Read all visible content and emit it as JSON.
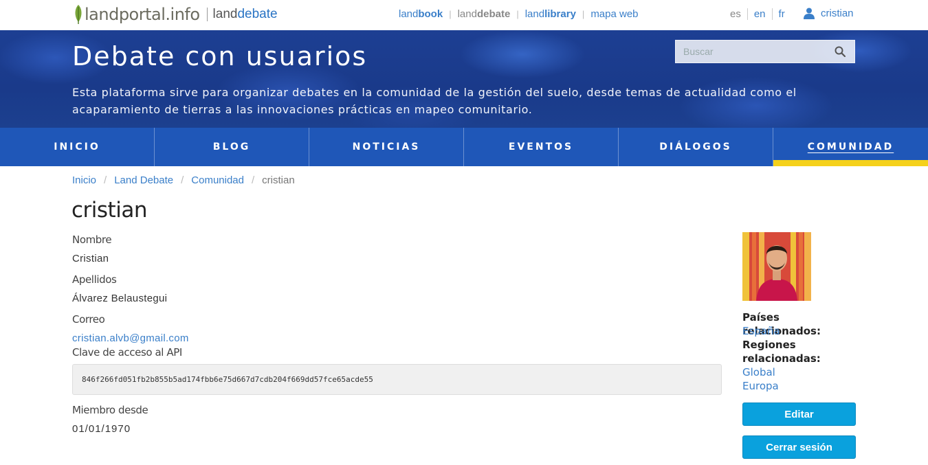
{
  "brand": {
    "logo_text": "landportal.info",
    "sub_land": "land",
    "sub_debate": "debate"
  },
  "sites": [
    {
      "prefix": "land",
      "bold": "book"
    },
    {
      "prefix": "land",
      "bold": "debate"
    },
    {
      "prefix": "land",
      "bold": "library"
    },
    {
      "prefix": "mapa web",
      "bold": ""
    }
  ],
  "languages": [
    "es",
    "en",
    "fr"
  ],
  "user": {
    "name": "cristian",
    "icon": "user-icon"
  },
  "hero": {
    "title": "Debate con usuarios",
    "description": "Esta plataforma sirve para organizar debates en la comunidad de la gestión del suelo, desde temas de actualidad como el acaparamiento de tierras a las innovaciones prácticas en mapeo comunitario.",
    "search_placeholder": "Buscar",
    "search_icon": "search-icon"
  },
  "nav": [
    "INICIO",
    "BLOG",
    "NOTICIAS",
    "EVENTOS",
    "DIÁLOGOS",
    "COMUNIDAD"
  ],
  "nav_active": "COMUNIDAD",
  "breadcrumb": [
    "Inicio",
    "Land Debate",
    "Comunidad",
    "cristian"
  ],
  "page_title": "cristian",
  "profile": {
    "nombre_label": "Nombre",
    "nombre": "Cristian",
    "apellidos_label": "Apellidos",
    "apellidos": "Álvarez Belaustegui",
    "correo_label": "Correo",
    "correo": "cristian.alvb@gmail.com",
    "api_label": "Clave de acceso al API",
    "api_key": "846f266fd051fb2b855b5ad174fbb6e75d667d7cdb204f669dd57fce65acde55",
    "miembro_label": "Miembro desde",
    "miembro": "01/01/1970"
  },
  "sidebar": {
    "paises_label": "Países relacionados:",
    "paises": [
      "España"
    ],
    "regiones_label": "Regiones relacionadas:",
    "regiones": [
      "Global",
      "Europa"
    ],
    "edit_button": "Editar",
    "logout_button": "Cerrar sesión"
  },
  "colors": {
    "accent": "#3a7fc9",
    "nav_bg": "#1f57b8",
    "nav_active_bar": "#f5d11b",
    "button": "#0aa1dd"
  }
}
